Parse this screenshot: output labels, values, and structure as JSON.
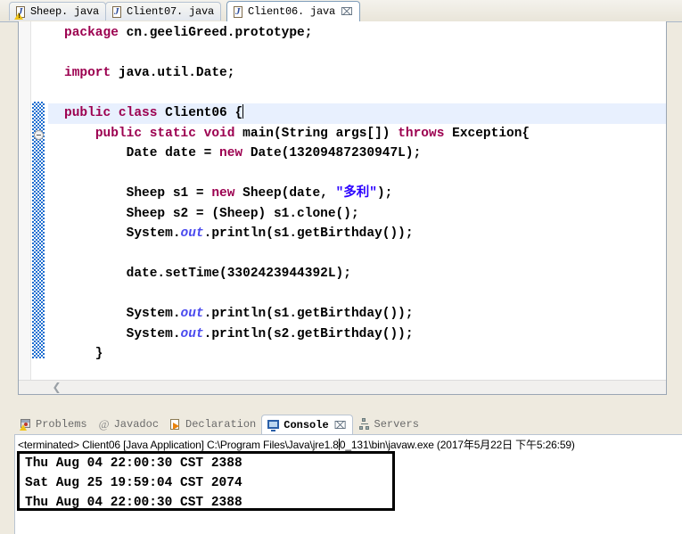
{
  "editor": {
    "tabs": [
      {
        "label": "Sheep. java",
        "icon": "java-file-warning-icon",
        "active": false,
        "closeable": false
      },
      {
        "label": "Client07. java",
        "icon": "java-file-icon",
        "active": false,
        "closeable": false
      },
      {
        "label": "Client06. java",
        "icon": "java-file-icon",
        "active": true,
        "closeable": true,
        "close_glyph": "⌧"
      }
    ],
    "code_lines": [
      {
        "id": "l1",
        "current": false,
        "tokens": [
          {
            "t": "kw",
            "v": "package"
          },
          {
            "t": "plain",
            "v": " cn.geeliGreed.prototype;"
          }
        ]
      },
      {
        "id": "l2",
        "current": false,
        "tokens": []
      },
      {
        "id": "l3",
        "current": false,
        "tokens": [
          {
            "t": "kw",
            "v": "import"
          },
          {
            "t": "plain",
            "v": " java.util.Date;"
          }
        ]
      },
      {
        "id": "l4",
        "current": false,
        "tokens": []
      },
      {
        "id": "l5",
        "current": true,
        "tokens": [
          {
            "t": "kw",
            "v": "public"
          },
          {
            "t": "plain",
            "v": " "
          },
          {
            "t": "kw",
            "v": "class"
          },
          {
            "t": "plain",
            "v": " Client06 {"
          },
          {
            "t": "caret",
            "v": ""
          }
        ]
      },
      {
        "id": "l6",
        "current": false,
        "tokens": [
          {
            "t": "plain",
            "v": "    "
          },
          {
            "t": "kw",
            "v": "public"
          },
          {
            "t": "plain",
            "v": " "
          },
          {
            "t": "kw",
            "v": "static"
          },
          {
            "t": "plain",
            "v": " "
          },
          {
            "t": "kw",
            "v": "void"
          },
          {
            "t": "plain",
            "v": " main(String args[]) "
          },
          {
            "t": "kw",
            "v": "throws"
          },
          {
            "t": "plain",
            "v": " Exception{"
          }
        ]
      },
      {
        "id": "l7",
        "current": false,
        "tokens": [
          {
            "t": "plain",
            "v": "        Date date = "
          },
          {
            "t": "kw",
            "v": "new"
          },
          {
            "t": "plain",
            "v": " Date(13209487230947L);"
          }
        ]
      },
      {
        "id": "l8",
        "current": false,
        "tokens": []
      },
      {
        "id": "l9",
        "current": false,
        "tokens": [
          {
            "t": "plain",
            "v": "        Sheep s1 = "
          },
          {
            "t": "kw",
            "v": "new"
          },
          {
            "t": "plain",
            "v": " Sheep(date, "
          },
          {
            "t": "str",
            "v": "\"多利\""
          },
          {
            "t": "plain",
            "v": ");"
          }
        ]
      },
      {
        "id": "l10",
        "current": false,
        "tokens": [
          {
            "t": "plain",
            "v": "        Sheep s2 = (Sheep) s1.clone();"
          }
        ]
      },
      {
        "id": "l11",
        "current": false,
        "tokens": [
          {
            "t": "plain",
            "v": "        System."
          },
          {
            "t": "statfld",
            "v": "out"
          },
          {
            "t": "plain",
            "v": ".println(s1.getBirthday());"
          }
        ]
      },
      {
        "id": "l12",
        "current": false,
        "tokens": []
      },
      {
        "id": "l13",
        "current": false,
        "tokens": [
          {
            "t": "plain",
            "v": "        date.setTime(3302423944392L);"
          }
        ]
      },
      {
        "id": "l14",
        "current": false,
        "tokens": []
      },
      {
        "id": "l15",
        "current": false,
        "tokens": [
          {
            "t": "plain",
            "v": "        System."
          },
          {
            "t": "statfld",
            "v": "out"
          },
          {
            "t": "plain",
            "v": ".println(s1.getBirthday());"
          }
        ]
      },
      {
        "id": "l16",
        "current": false,
        "tokens": [
          {
            "t": "plain",
            "v": "        System."
          },
          {
            "t": "statfld",
            "v": "out"
          },
          {
            "t": "plain",
            "v": ".println(s2.getBirthday());"
          }
        ]
      },
      {
        "id": "l17",
        "current": false,
        "tokens": [
          {
            "t": "plain",
            "v": "    }"
          }
        ]
      },
      {
        "id": "l18",
        "current": false,
        "tokens": []
      },
      {
        "id": "l19",
        "current": false,
        "tokens": [
          {
            "t": "bracematch",
            "v": "}"
          }
        ]
      }
    ],
    "scroll_left_arrow": "❮"
  },
  "bottom_view": {
    "tabs": [
      {
        "label": "Problems",
        "icon": "problems-icon",
        "active": false
      },
      {
        "label": "Javadoc",
        "icon": "javadoc-icon",
        "active": false
      },
      {
        "label": "Declaration",
        "icon": "declaration-icon",
        "active": false
      },
      {
        "label": "Console",
        "icon": "console-icon",
        "active": true,
        "close_glyph": "⌧"
      },
      {
        "label": "Servers",
        "icon": "servers-icon",
        "active": false
      }
    ]
  },
  "console": {
    "launch_prefix": "<terminated> Client06 [Java Application] C:\\Program Files\\Java\\jre1.8",
    "launch_suffix": "0_131\\bin\\javaw.exe (2017年5月22日 下午5:26:59)",
    "output_lines": [
      "Thu Aug 04 22:00:30 CST 2388",
      "Sat Aug 25 19:59:04 CST 2074",
      "Thu Aug 04 22:00:30 CST 2388"
    ]
  },
  "colors": {
    "keyword": "#9c0050",
    "string": "#2a00ff",
    "static_field": "#4a4aee",
    "current_line_highlight": "#e8f0fe",
    "fold_region": "#1f6fd0",
    "window_chrome": "#eeeadf"
  }
}
